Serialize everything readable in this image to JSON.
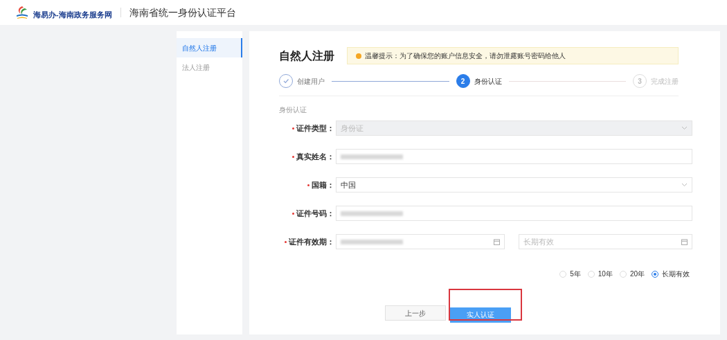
{
  "header": {
    "logo_text": "海易办-海南政务服务网",
    "title": "海南省统一身份认证平台"
  },
  "sidebar": {
    "items": [
      {
        "label": "自然人注册",
        "selected": true
      },
      {
        "label": "法人注册",
        "selected": false
      }
    ]
  },
  "page": {
    "title": "自然人注册",
    "notice": "温馨提示：为了确保您的账户信息安全，请勿泄露账号密码给他人"
  },
  "steps": [
    {
      "label": "创建用户",
      "completed": true,
      "selected": false
    },
    {
      "number": "2",
      "label": "身份认证",
      "completed": false,
      "selected": true
    },
    {
      "number": "3",
      "label": "完成注册",
      "completed": false,
      "selected": false
    }
  ],
  "section_label": "身份认证",
  "fields": [
    {
      "label": "证件类型：",
      "kind": "select",
      "value": "身份证",
      "disabled": true
    },
    {
      "label": "真实姓名：",
      "kind": "redacted",
      "disabled": false
    },
    {
      "label": "国籍：",
      "kind": "select",
      "value": "中国",
      "disabled": false
    },
    {
      "label": "证件号码：",
      "kind": "redacted",
      "disabled": false
    },
    {
      "label": "证件有效期：",
      "kind": "daterange",
      "disabled": false,
      "end_placeholder": "长期有效"
    }
  ],
  "validity_options": [
    {
      "label": "5年",
      "selected": false
    },
    {
      "label": "10年",
      "selected": false
    },
    {
      "label": "20年",
      "selected": false
    },
    {
      "label": "长期有效",
      "selected": true
    }
  ],
  "buttons": [
    {
      "label": "上一步",
      "kind": "secondary",
      "highlighted": false
    },
    {
      "label": "实人认证",
      "kind": "primary",
      "highlighted": true
    }
  ]
}
